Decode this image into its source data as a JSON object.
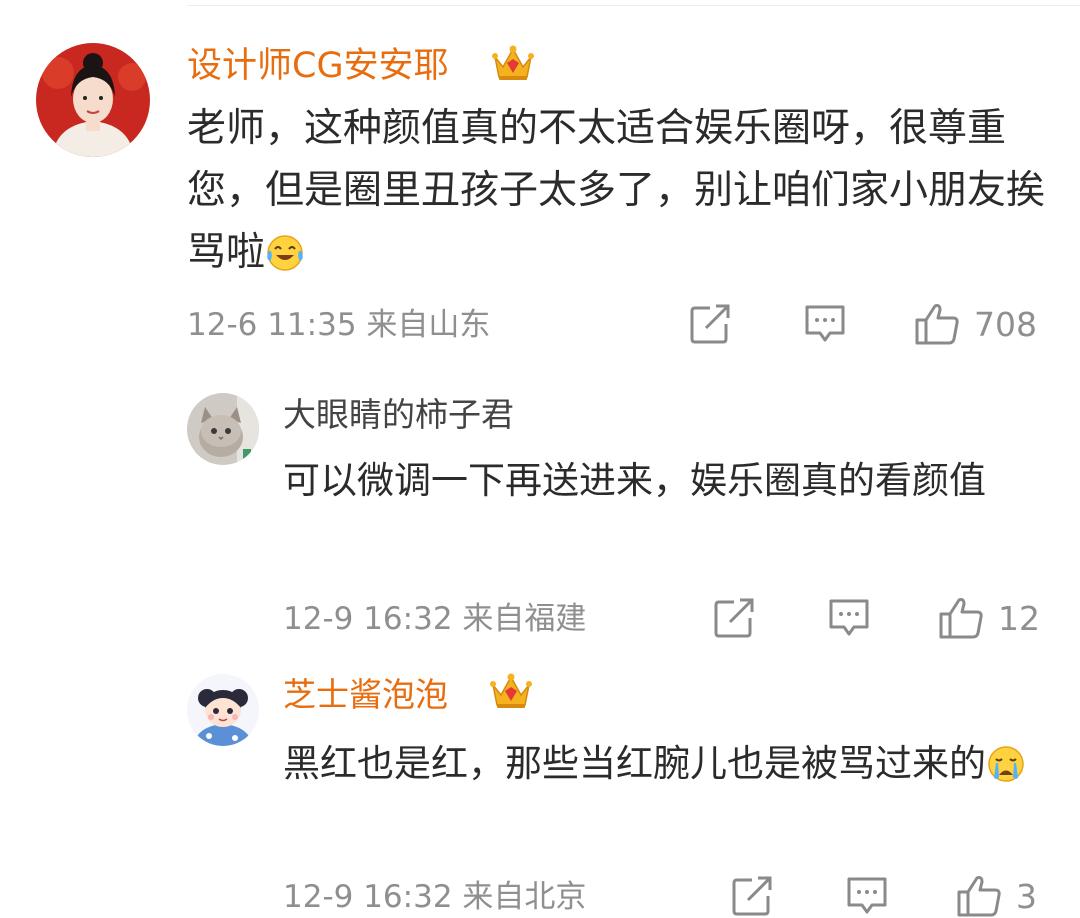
{
  "comments": [
    {
      "username": "设计师CG安安耶",
      "text": "老师，这种颜值真的不太适合娱乐圈呀，很尊重您，但是圈里丑孩子太多了，别让咱们家小朋友挨骂啦",
      "emoji": "laughing-crying-emoji",
      "timestamp": "12-6 11:35",
      "location": "来自山东",
      "likes": "708",
      "badge": "crown-badge-icon"
    },
    {
      "username": "大眼睛的柿子君",
      "text": "可以微调一下再送进来，娱乐圈真的看颜值",
      "timestamp": "12-9 16:32",
      "location": "来自福建",
      "likes": "12"
    },
    {
      "username": "芝士酱泡泡",
      "text": "黑红也是红，那些当红腕儿也是被骂过来的",
      "emoji": "crying-emoji",
      "timestamp": "12-9 16:32",
      "location": "来自北京",
      "likes": "3",
      "badge": "crown-badge-icon"
    }
  ],
  "colors": {
    "vip_name": "#e86d0f",
    "meta_text": "#8f8f8f",
    "body_text": "#2b2b2b",
    "icon": "#8a8a8a"
  }
}
